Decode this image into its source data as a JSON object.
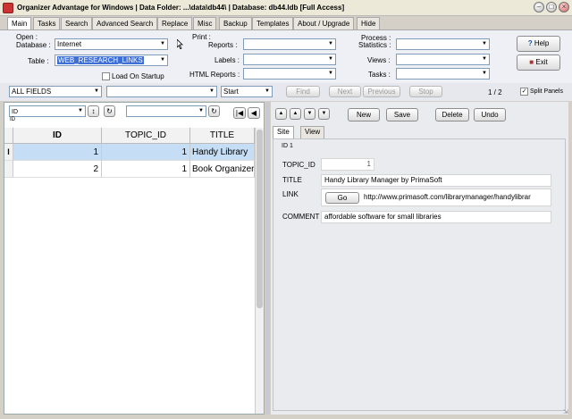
{
  "window": {
    "title": "Organizer Advantage for Windows | Data Folder: ...\\data\\db44\\ | Database: db44.ldb [Full Access]"
  },
  "tabs": [
    "Main",
    "Tasks",
    "Search",
    "Advanced Search",
    "Replace",
    "Misc",
    "Backup",
    "Templates",
    "About / Upgrade",
    "Hide"
  ],
  "open": {
    "group_label": "Open :",
    "database_label": "Database :",
    "database_value": "Internet",
    "table_label": "Table :",
    "table_value": "WEB_RESEARCH_LINKS",
    "load_on_startup": "Load On Startup"
  },
  "print": {
    "group_label": "Print :",
    "reports_label": "Reports :",
    "labels_label": "Labels :",
    "html_reports_label": "HTML Reports :"
  },
  "process": {
    "group_label": "Process :",
    "statistics_label": "Statistics :",
    "views_label": "Views :",
    "tasks_label": "Tasks :"
  },
  "help_button": "Help",
  "exit_button": "Exit",
  "search": {
    "field_value": "ALL FIELDS",
    "mode_value": "Start",
    "find": "Find",
    "next": "Next",
    "previous": "Previous",
    "stop": "Stop",
    "record_counter": "1 / 2",
    "split_panels": "Split Panels"
  },
  "grid_controls": {
    "sort_field": "ID",
    "sort_sub": "ID"
  },
  "grid": {
    "columns": [
      "ID",
      "TOPIC_ID",
      "TITLE"
    ],
    "rows": [
      {
        "marker": "I",
        "id": "1",
        "topic_id": "1",
        "title": "Handy Library"
      },
      {
        "marker": "",
        "id": "2",
        "topic_id": "1",
        "title": "Book Organizer"
      }
    ]
  },
  "actions": {
    "new": "New",
    "save": "Save",
    "delete": "Delete",
    "undo": "Undo"
  },
  "detail": {
    "tab_site": "Site",
    "tab_view": "View",
    "record_id": "ID 1",
    "topic_id_label": "TOPIC_ID",
    "topic_id_value": "1",
    "title_label": "TITLE",
    "title_value": "Handy Library Manager by PrimaSoft",
    "link_label": "LINK",
    "link_go": "Go",
    "link_value": "http://www.primasoft.com/librarymanager/handylibrar",
    "comment_label": "COMMENT",
    "comment_value": "affordable software for small libraries"
  },
  "colors": {
    "selected_row": "#c6def5",
    "table_highlight": "#3d6fd6"
  }
}
